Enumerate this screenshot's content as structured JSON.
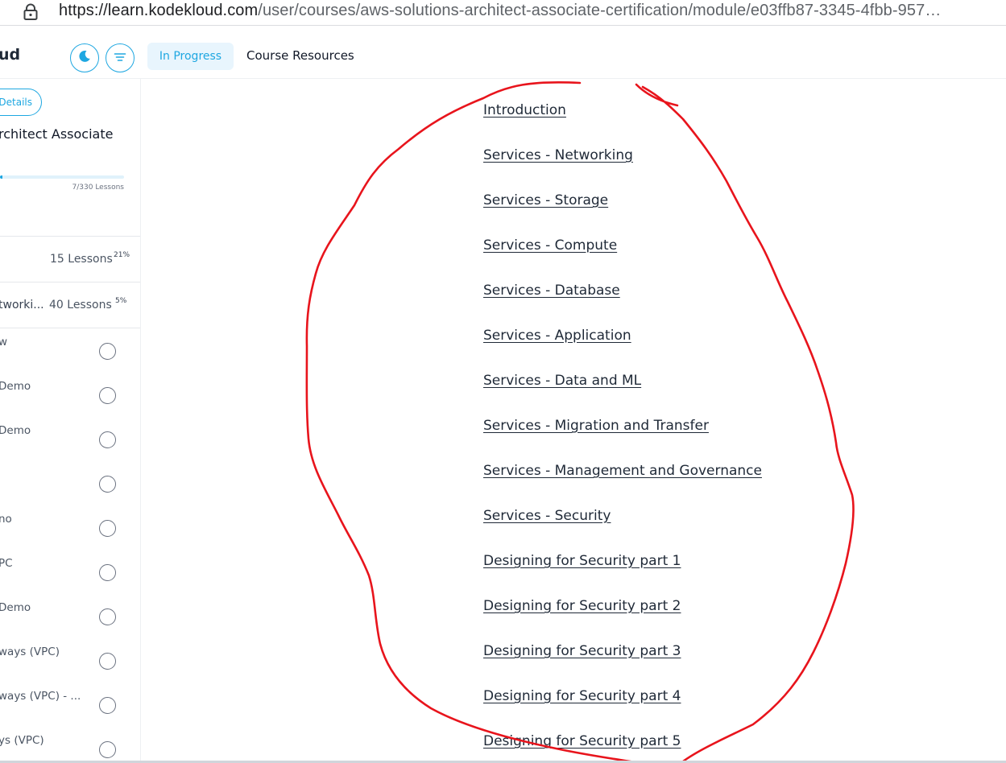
{
  "url_bar": {
    "host": "https://learn.kodekloud.com",
    "path": "/user/courses/aws-solutions-architect-associate-certification/module/e03ffb87-3345-4fbb-957…",
    "lock_icon": "lock-icon"
  },
  "header": {
    "brand": "ud",
    "theme_icon": "moon-icon",
    "menu_icon": "menu-lines-icon",
    "status_pill": "In Progress",
    "resources_link": "Course Resources",
    "accent_color": "#1ea7e1"
  },
  "sidebar": {
    "details_button": "Details",
    "course_title": "rchitect Associate",
    "progress": {
      "completed": 7,
      "total": 330,
      "label": "7/330 Lessons"
    },
    "sections": [
      {
        "name": "",
        "lessons": "15 Lessons",
        "percent": "21%"
      },
      {
        "name": "tworki...",
        "lessons": "40 Lessons",
        "percent": "5%"
      }
    ],
    "lessons": [
      {
        "label": "w"
      },
      {
        "label": "Demo"
      },
      {
        "label": "Demo"
      },
      {
        "label": ""
      },
      {
        "label": "no"
      },
      {
        "label": "PC"
      },
      {
        "label": "Demo"
      },
      {
        "label": "ways (VPC)"
      },
      {
        "label": "ways (VPC) - ..."
      },
      {
        "label": "ys (VPC)"
      }
    ]
  },
  "modules": [
    "Introduction",
    "Services - Networking",
    "Services - Storage",
    "Services - Compute",
    "Services - Database",
    "Services - Application",
    "Services - Data and ML",
    "Services - Migration and Transfer",
    "Services - Management and Governance",
    "Services - Security",
    "Designing for Security part 1",
    "Designing for Security part 2",
    "Designing for Security part 3",
    "Designing for Security part 4",
    "Designing for Security part 5"
  ],
  "annotation": {
    "color": "#e8141c"
  }
}
